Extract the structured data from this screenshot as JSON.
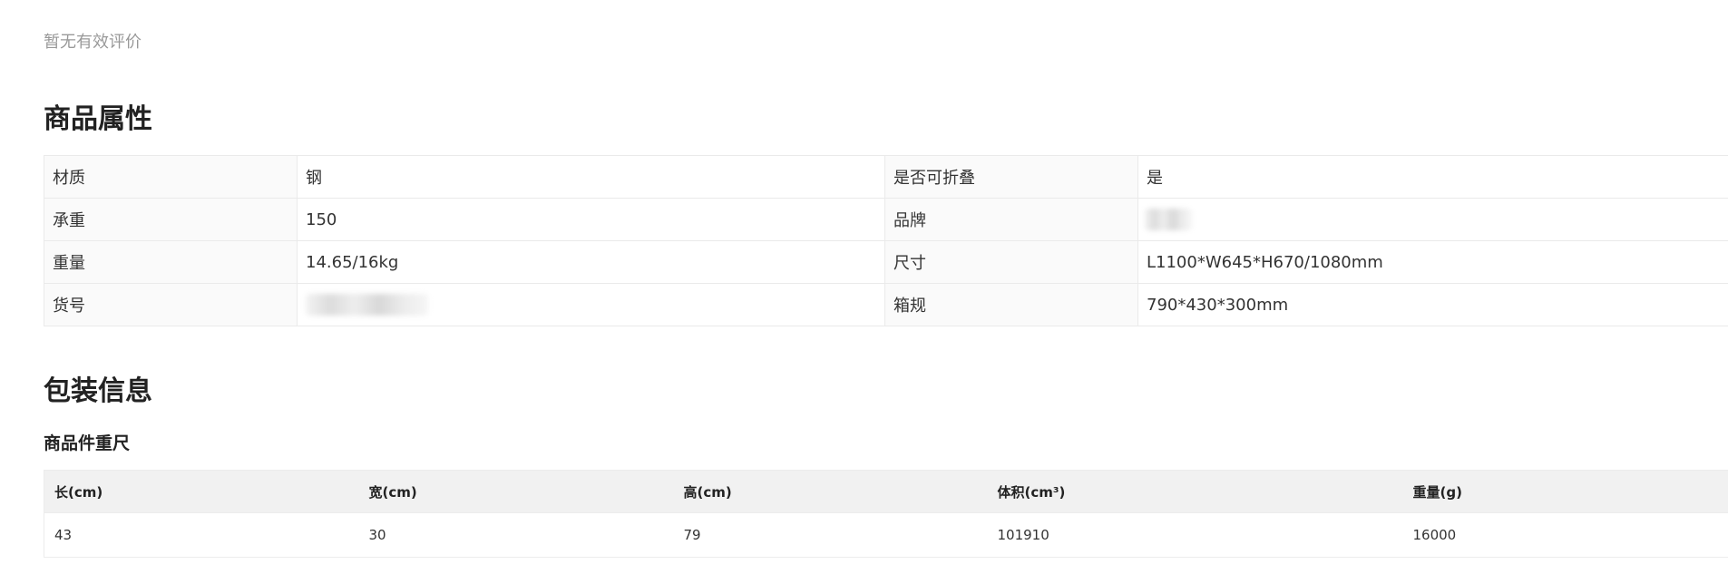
{
  "reviews": {
    "empty_text": "暂无有效评价"
  },
  "attributes": {
    "title": "商品属性",
    "rows": [
      {
        "k1": "材质",
        "v1": "钢",
        "k2": "是否可折叠",
        "v2": "是"
      },
      {
        "k1": "承重",
        "v1": "150",
        "k2": "品牌",
        "v2": ""
      },
      {
        "k1": "重量",
        "v1": "14.65/16kg",
        "k2": "尺寸",
        "v2": "L1100*W645*H670/1080mm"
      },
      {
        "k1": "货号",
        "v1": "",
        "k2": "箱规",
        "v2": "790*430*300mm"
      }
    ]
  },
  "packaging": {
    "title": "包装信息",
    "subtitle": "商品件重尺",
    "headers": [
      "长(cm)",
      "宽(cm)",
      "高(cm)",
      "体积(cm³)",
      "重量(g)"
    ],
    "values": [
      "43",
      "30",
      "79",
      "101910",
      "16000"
    ]
  }
}
